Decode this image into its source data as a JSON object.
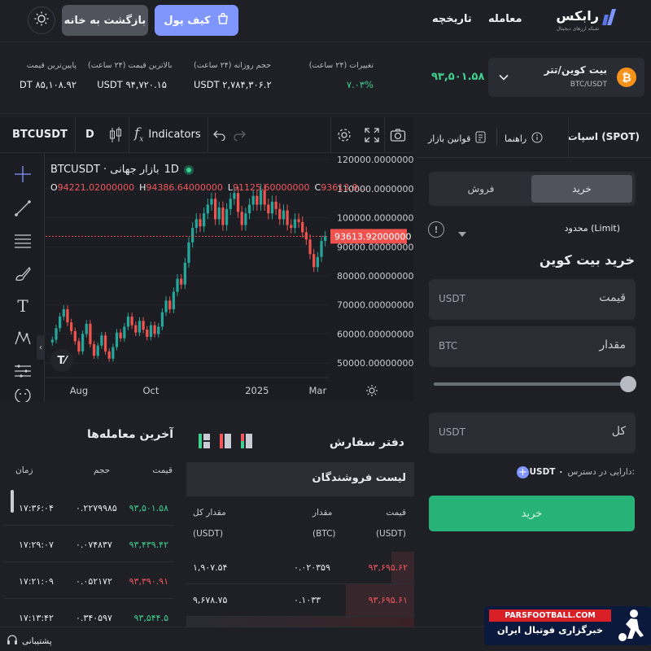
{
  "header": {
    "theme_icon": "sun-icon",
    "home_label": "بازگشت به خانه",
    "wallet_label": "کیف پول",
    "nav": [
      "تاریخچه",
      "معامله"
    ],
    "logo_text": "رابکس",
    "logo_subtext": "شبکه ارزهای دیجیتال"
  },
  "ticker": {
    "low_label": "پایین‌ترین قیمت",
    "low_value": "DT ۸۵,۱۰۸.۹۲",
    "high_label": "بالاترین قیمت (۲۴ ساعت)",
    "high_value": "USDT ۹۴,۷۲۰.۱۵",
    "volume_label": "حجم روزانه (۲۴ ساعت)",
    "volume_value": "USDT ۲,۷۸۴,۳۰۶.۲",
    "change_label": "تغییرات (۲۴ ساعت)",
    "change_value": "۷.۰۳%",
    "last_price": "۹۳,۵۰۱.۵۸",
    "pair_name": "بیت کوین/تتر",
    "pair_symbol": "BTC/USDT"
  },
  "chart_toolbar": {
    "symbol": "BTCUSDT",
    "interval": "D",
    "indicators_label": "Indicators"
  },
  "chart_data": {
    "type": "candlestick",
    "symbol_label": "BTCUSDT · بازار جهانی",
    "interval": "1D",
    "ohlc": {
      "o": "94221.02000000",
      "h": "94386.64000000",
      "l": "91125.60000000",
      "c": "93613.9..."
    },
    "current_price": "93613.92000000",
    "ylim": [
      45000,
      122000
    ],
    "y_ticks": [
      "120000.00000000",
      "110000.00000000",
      "100000.00000000",
      "90000.00000000",
      "80000.00000000",
      "70000.00000000",
      "60000.00000000",
      "50000.00000000"
    ],
    "x_ticks": [
      "Aug",
      "Oct",
      "2025",
      "Mar"
    ],
    "closes": [
      58000,
      62000,
      66000,
      68500,
      64000,
      61000,
      57500,
      54000,
      60000,
      63500,
      56500,
      52500,
      56000,
      59500,
      54000,
      51500,
      55500,
      60500,
      58500,
      62500,
      66000,
      63000,
      60500,
      64500,
      61500,
      59000,
      63000,
      60000,
      62500,
      67500,
      71500,
      68500,
      74500,
      79000,
      77000,
      84500,
      91500,
      96500,
      99500,
      97000,
      101500,
      104500,
      106500,
      99500,
      103500,
      97500,
      103000,
      106500,
      108500,
      102000,
      97500,
      101500,
      104500,
      107500,
      104500,
      109500,
      104500,
      101500,
      105500,
      103000,
      99500,
      102500,
      97500,
      96500,
      99500,
      98500,
      95000,
      92500,
      87500,
      83000,
      86500,
      92000,
      93600
    ],
    "colors": {
      "up": "#26a69a",
      "down": "#ef5350"
    }
  },
  "trade": {
    "title": "اسپات (SPOT)",
    "tab_guide": "راهنما",
    "tab_rules": "قوانین بازار",
    "buy_tab": "خرید",
    "sell_tab": "فروش",
    "order_type": "محدود (Limit)",
    "form_title": "خرید بیت کوین",
    "price_label": "قیمت",
    "price_unit": "USDT",
    "amount_label": "مقدار",
    "amount_unit": "BTC",
    "slider_percent": 100,
    "total_label": "کل",
    "total_unit": "USDT",
    "available_label": "دارایی در دسترس:",
    "available_value": "USDT ۰",
    "submit_label": "خرید",
    "colors": {
      "accent": "#7f96ff",
      "buy": "#27b378"
    }
  },
  "trades": {
    "title": "آخرین معامله‌ها",
    "headers": [
      "قیمت",
      "حجم",
      "زمان"
    ],
    "rows": [
      {
        "price": "۹۳,۵۰۱.۵۸",
        "volume": "۰.۲۲۷۹۹۸۵",
        "time": "۱۷:۳۶:۰۴",
        "side": "buy"
      },
      {
        "price": "۹۳,۴۳۹.۴۲",
        "volume": "۰.۰۷۴۸۳۷",
        "time": "۱۷:۲۹:۰۷",
        "side": "buy"
      },
      {
        "price": "۹۳,۳۹۰.۹۱",
        "volume": "۰.۰۵۲۱۷۲",
        "time": "۱۷:۲۱:۰۹",
        "side": "sell"
      },
      {
        "price": "۹۳,۵۴۴.۵",
        "volume": "۰.۳۴۰۵۹۷",
        "time": "۱۷:۱۳:۴۲",
        "side": "buy"
      }
    ]
  },
  "orderbook": {
    "title": "دفتر سفارش",
    "sellers_title": "لیست فروشندگان",
    "headers": [
      "قیمت",
      "مقدار",
      "مقدار کل"
    ],
    "units": [
      "(USDT)",
      "(BTC)",
      "(USDT)"
    ],
    "rows": [
      {
        "price": "۹۳,۶۹۵.۶۲",
        "amount": "۰.۰۲۰۳۵۹",
        "total": "۱,۹۰۷.۵۴",
        "depth": 0.1
      },
      {
        "price": "۹۳,۶۹۵.۶۱",
        "amount": "۰.۱۰۳۳",
        "total": "۹,۶۷۸.۷۵",
        "depth": 0.3
      }
    ]
  },
  "footer": {
    "support_label": "پشتیبانی"
  },
  "watermark": {
    "text": "PARSFOOTBALL.COM",
    "subtext": "خبرگزاری فوتبال ایران"
  }
}
